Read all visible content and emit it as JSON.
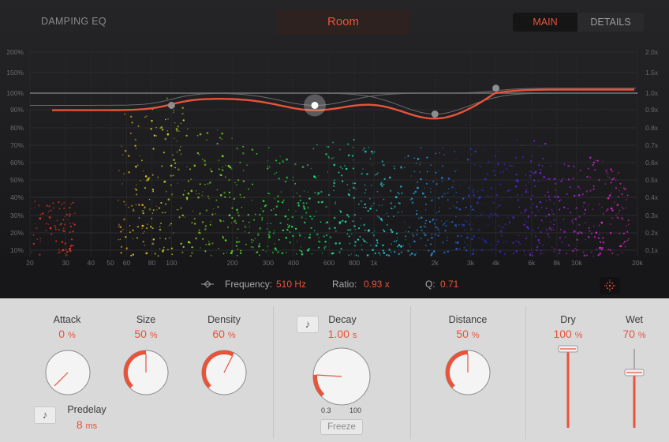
{
  "header": {
    "title": "DAMPING EQ",
    "preset": "Room",
    "tabs": [
      {
        "label": "MAIN",
        "active": true
      },
      {
        "label": "DETAILS",
        "active": false
      }
    ]
  },
  "graph": {
    "y_left_ticks": [
      "200%",
      "150%",
      "100%",
      "90%",
      "80%",
      "70%",
      "60%",
      "50%",
      "40%",
      "30%",
      "20%",
      "10%"
    ],
    "y_right_ticks": [
      "2.0x",
      "1.5x",
      "1.0x",
      "0.9x",
      "0.8x",
      "0.7x",
      "0.6x",
      "0.5x",
      "0.4x",
      "0.3x",
      "0.2x",
      "0.1x"
    ],
    "x_ticks": [
      "20",
      "30",
      "40",
      "50",
      "60",
      "80",
      "100",
      "200",
      "300",
      "400",
      "600",
      "800",
      "1k",
      "2k",
      "3k",
      "4k",
      "6k",
      "8k",
      "10k",
      "20k"
    ],
    "curve_color": "#e8533a",
    "eq_points": [
      {
        "freq_hz": 100,
        "ratio": 0.93
      },
      {
        "freq_hz": 510,
        "ratio": 0.93,
        "selected": true
      },
      {
        "freq_hz": 2000,
        "ratio": 0.88
      },
      {
        "freq_hz": 4000,
        "ratio": 1.12
      }
    ]
  },
  "info": {
    "icon": "eq-band-icon",
    "frequency_label": "Frequency:",
    "frequency_value": "510 Hz",
    "ratio_label": "Ratio:",
    "ratio_value": "0.93 x",
    "q_label": "Q:",
    "q_value": "0.71",
    "scatter_icon": "particle-display-icon"
  },
  "controls": {
    "attack": {
      "label": "Attack",
      "value": "0",
      "unit": "%",
      "fraction": 0.0
    },
    "size": {
      "label": "Size",
      "value": "50",
      "unit": "%",
      "fraction": 0.5
    },
    "density": {
      "label": "Density",
      "value": "60",
      "unit": "%",
      "fraction": 0.6
    },
    "predelay": {
      "label": "Predelay",
      "value": "8",
      "unit": "ms"
    },
    "decay": {
      "label": "Decay",
      "value": "1.00",
      "unit": "s",
      "min_label": "0.3",
      "max_label": "100",
      "fraction": 0.18
    },
    "freeze_label": "Freeze",
    "distance": {
      "label": "Distance",
      "value": "50",
      "unit": "%",
      "fraction": 0.5
    },
    "dry": {
      "label": "Dry",
      "value": "100",
      "unit": "%",
      "fraction": 1.0
    },
    "wet": {
      "label": "Wet",
      "value": "70",
      "unit": "%",
      "fraction": 0.7
    },
    "note_icon": "♪"
  }
}
